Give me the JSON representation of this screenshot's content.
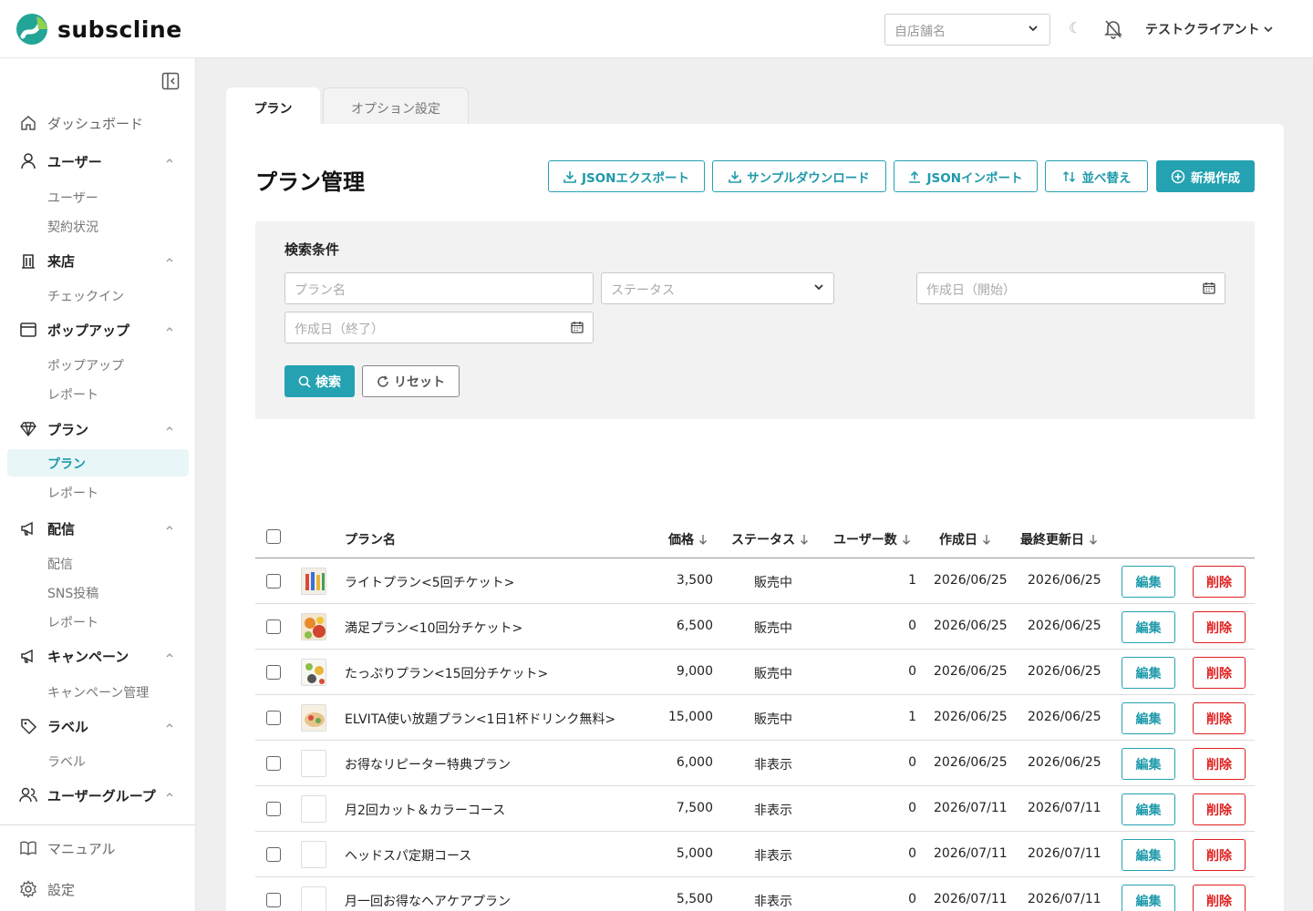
{
  "header": {
    "brand": "subscline",
    "store_placeholder": "自店舗名",
    "user_name": "テストクライアント"
  },
  "sidebar": {
    "dashboard": "ダッシュボード",
    "users_group": "ユーザー",
    "users_sub": [
      "ユーザー",
      "契約状況"
    ],
    "visit_group": "来店",
    "visit_sub": [
      "チェックイン"
    ],
    "popup_group": "ポップアップ",
    "popup_sub": [
      "ポップアップ",
      "レポート"
    ],
    "plan_group": "プラン",
    "plan_sub": [
      "プラン",
      "レポート"
    ],
    "delivery_group": "配信",
    "delivery_sub": [
      "配信",
      "SNS投稿",
      "レポート"
    ],
    "campaign_group": "キャンペーン",
    "campaign_sub": [
      "キャンペーン管理"
    ],
    "label_group": "ラベル",
    "label_sub": [
      "ラベル"
    ],
    "usergroup_group": "ユーザーグループ",
    "manual": "マニュアル",
    "settings": "設定"
  },
  "tabs": [
    "プラン",
    "オプション設定"
  ],
  "page": {
    "title": "プラン管理",
    "actions": {
      "json_export": "JSONエクスポート",
      "sample_download": "サンプルダウンロード",
      "json_import": "JSONインポート",
      "sort": "並べ替え",
      "create": "新規作成"
    }
  },
  "search": {
    "title": "検索条件",
    "plan_name_placeholder": "プラン名",
    "status_placeholder": "ステータス",
    "created_start_placeholder": "作成日（開始）",
    "created_end_placeholder": "作成日（終了）",
    "search_label": "検索",
    "reset_label": "リセット"
  },
  "table": {
    "columns": {
      "name": "プラン名",
      "price": "価格",
      "status": "ステータス",
      "users": "ユーザー数",
      "created": "作成日",
      "updated": "最終更新日"
    },
    "edit_label": "編集",
    "delete_label": "削除",
    "rows": [
      {
        "name": "ライトプラン<5回チケット>",
        "price": "3,500",
        "status": "販売中",
        "users": "1",
        "created": "2026/06/25",
        "updated": "2026/06/25",
        "has_image": true
      },
      {
        "name": "満足プラン<10回分チケット>",
        "price": "6,500",
        "status": "販売中",
        "users": "0",
        "created": "2026/06/25",
        "updated": "2026/06/25",
        "has_image": true
      },
      {
        "name": "たっぷりプラン<15回分チケット>",
        "price": "9,000",
        "status": "販売中",
        "users": "0",
        "created": "2026/06/25",
        "updated": "2026/06/25",
        "has_image": true
      },
      {
        "name": "ELVITA使い放題プラン<1日1杯ドリンク無料>",
        "price": "15,000",
        "status": "販売中",
        "users": "1",
        "created": "2026/06/25",
        "updated": "2026/06/25",
        "has_image": true
      },
      {
        "name": "お得なリピーター特典プラン",
        "price": "6,000",
        "status": "非表示",
        "users": "0",
        "created": "2026/06/25",
        "updated": "2026/06/25",
        "has_image": false
      },
      {
        "name": "月2回カット＆カラーコース",
        "price": "7,500",
        "status": "非表示",
        "users": "0",
        "created": "2026/07/11",
        "updated": "2026/07/11",
        "has_image": false
      },
      {
        "name": "ヘッドスパ定期コース",
        "price": "5,000",
        "status": "非表示",
        "users": "0",
        "created": "2026/07/11",
        "updated": "2026/07/11",
        "has_image": false
      },
      {
        "name": "月一回お得なヘアケアプラン",
        "price": "5,500",
        "status": "非表示",
        "users": "0",
        "created": "2026/07/11",
        "updated": "2026/07/11",
        "has_image": false
      }
    ]
  },
  "colors": {
    "accent": "#25a2b2",
    "danger": "#e02020",
    "active_bg": "#e9f6f7"
  }
}
